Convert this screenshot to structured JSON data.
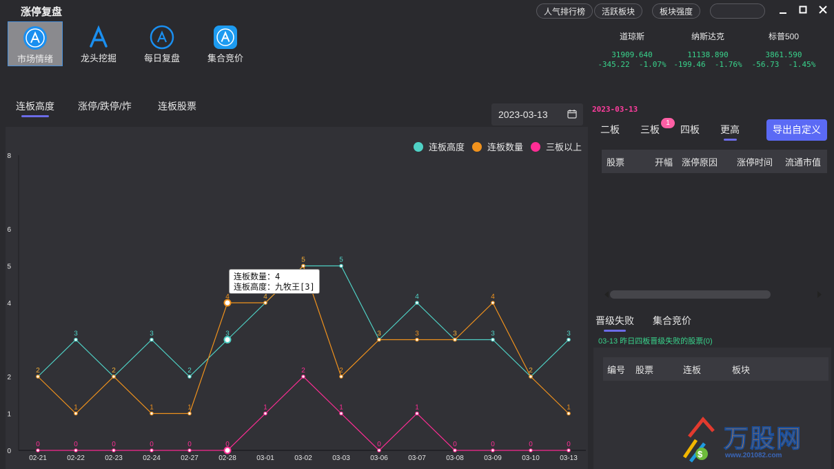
{
  "app": {
    "title": "涨停复盘"
  },
  "topbar": {
    "buttons": [
      "人气排行榜",
      "活跃板块",
      "板块强度"
    ],
    "search_value": ""
  },
  "nav": {
    "items": [
      {
        "label": "市场情绪",
        "icon": "app-store-icon",
        "active": true
      },
      {
        "label": "龙头挖掘",
        "icon": "app-store-a-icon",
        "active": false
      },
      {
        "label": "每日复盘",
        "icon": "app-store-icon",
        "active": false
      },
      {
        "label": "集合竞价",
        "icon": "app-store-app-icon",
        "active": false
      }
    ]
  },
  "indices": [
    {
      "name": "道琼斯",
      "value": "31909.640",
      "change": "-345.22",
      "pct": "-1.07%"
    },
    {
      "name": "纳斯达克",
      "value": "11138.890",
      "change": "-199.46",
      "pct": "-1.76%"
    },
    {
      "name": "标普500",
      "value": "3861.590",
      "change": "-56.73",
      "pct": "-1.45%"
    }
  ],
  "main": {
    "tabs": [
      "连板高度",
      "涨停/跌停/炸",
      "连板股票"
    ],
    "active_tab": 0,
    "date": "2023-03-13"
  },
  "tooltip": {
    "line1": "连板数量：4",
    "line2": "连板高度：九牧王[3]"
  },
  "chart_data": {
    "type": "line",
    "x": [
      "02-21",
      "02-22",
      "02-23",
      "02-24",
      "02-27",
      "02-28",
      "03-01",
      "03-02",
      "03-03",
      "03-06",
      "03-07",
      "03-08",
      "03-09",
      "03-10",
      "03-13"
    ],
    "ylim": [
      0,
      8
    ],
    "yticks": [
      "0",
      "1",
      "2",
      "4",
      "5",
      "6",
      "8"
    ],
    "legend_position": "top-right",
    "grid": false,
    "series": [
      {
        "name": "连板高度",
        "color": "#4fd1c5",
        "values": [
          2,
          3,
          2,
          3,
          2,
          3,
          4,
          5,
          5,
          3,
          4,
          3,
          3,
          2,
          3
        ]
      },
      {
        "name": "连板数量",
        "color": "#f0921d",
        "values": [
          2,
          1,
          2,
          1,
          1,
          4,
          4,
          5,
          2,
          3,
          3,
          3,
          4,
          2,
          1
        ]
      },
      {
        "name": "三板以上",
        "color": "#ff2d95",
        "values": [
          0,
          0,
          0,
          0,
          0,
          0,
          1,
          2,
          1,
          0,
          1,
          0,
          0,
          0,
          0
        ]
      }
    ]
  },
  "right": {
    "date": "2023-03-13",
    "tabs": [
      "二板",
      "三板",
      "四板",
      "更高"
    ],
    "badge": "1",
    "export_label": "导出自定义",
    "table_headers": [
      "股票",
      "开幅",
      "涨停原因",
      "涨停时间",
      "流通市值"
    ]
  },
  "fail": {
    "tabs": [
      "晋级失败",
      "集合竞价"
    ],
    "note": "03-13 昨日四板晋级失败的股票(0)",
    "table_headers": [
      "编号",
      "股票",
      "连板",
      "板块"
    ]
  },
  "watermark": {
    "brand": "万股网",
    "url": "www.201082.com"
  },
  "colors": {
    "accent": "#5b6af5",
    "up": "#39d48c",
    "highlight": "#ff3d9e"
  }
}
